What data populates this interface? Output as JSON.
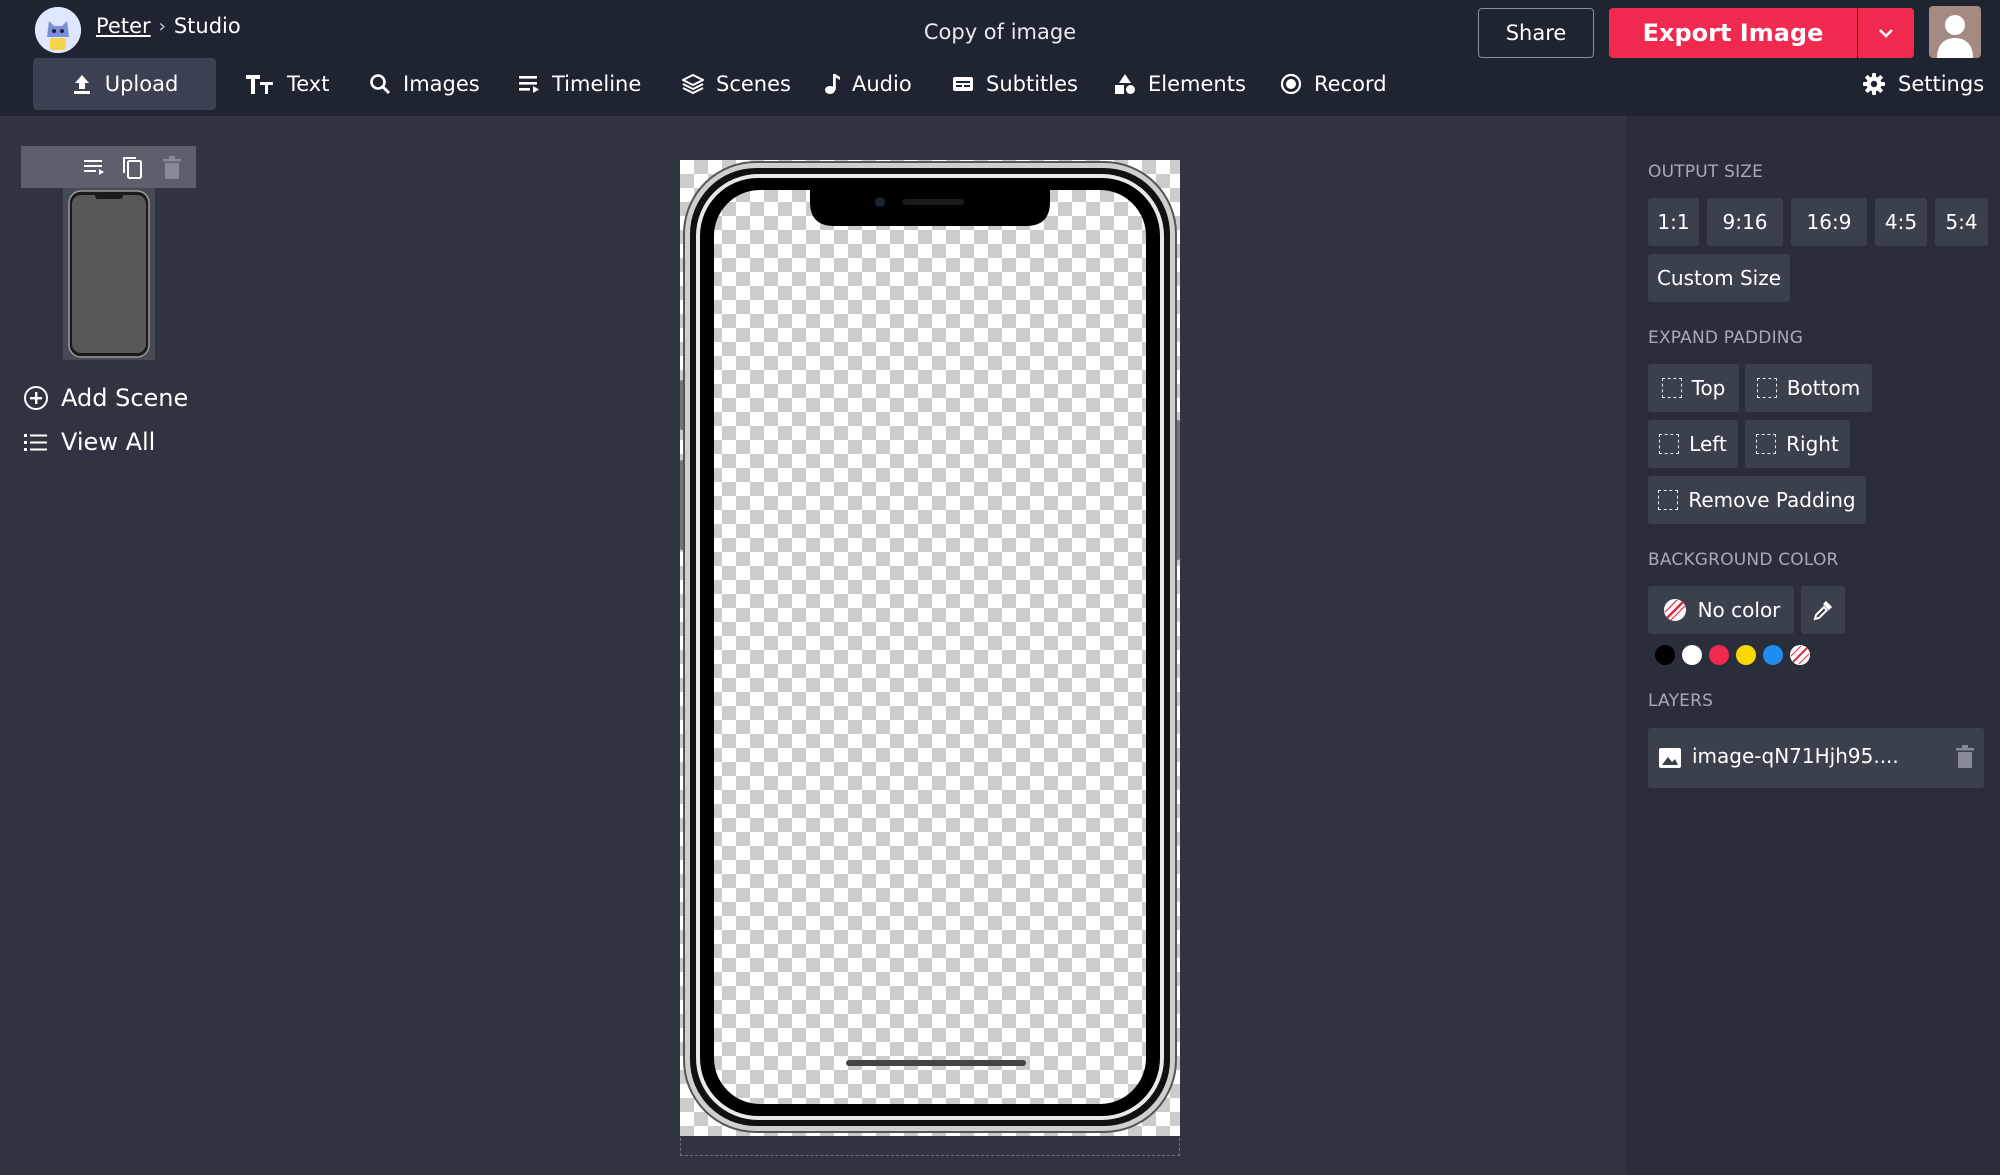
{
  "header": {
    "user_name": "Peter",
    "separator": "›",
    "location": "Studio",
    "doc_title": "Copy of image",
    "share_label": "Share",
    "export_label": "Export Image"
  },
  "nav": {
    "upload": "Upload",
    "text": "Text",
    "images": "Images",
    "timeline": "Timeline",
    "scenes": "Scenes",
    "audio": "Audio",
    "subtitles": "Subtitles",
    "elements": "Elements",
    "record": "Record",
    "settings": "Settings"
  },
  "left_panel": {
    "add_scene": "Add Scene",
    "view_all": "View All"
  },
  "right_panel": {
    "output_size": {
      "title": "OUTPUT SIZE",
      "options": [
        "1:1",
        "9:16",
        "16:9",
        "4:5",
        "5:4"
      ],
      "custom": "Custom Size"
    },
    "expand_padding": {
      "title": "EXPAND PADDING",
      "top": "Top",
      "bottom": "Bottom",
      "left": "Left",
      "right": "Right",
      "remove": "Remove Padding"
    },
    "background_color": {
      "title": "BACKGROUND COLOR",
      "current": "No color",
      "swatches": [
        "#000000",
        "#ffffff",
        "#f0294f",
        "#f7d800",
        "#1f8ef1",
        "none"
      ]
    },
    "layers": {
      "title": "LAYERS",
      "items": [
        {
          "name": "image-qN71Hjh95...."
        }
      ]
    }
  },
  "icons": {
    "upload": "upload-icon",
    "text": "text-icon",
    "images": "search-icon",
    "timeline": "timeline-icon",
    "scenes": "layers-icon",
    "audio": "music-note-icon",
    "subtitles": "subtitles-icon",
    "elements": "shapes-icon",
    "record": "record-icon",
    "settings": "gear-icon"
  },
  "colors": {
    "accent": "#f0294f",
    "topbar": "#1f2431",
    "workspace": "#303440",
    "panel": "#292e3a"
  }
}
